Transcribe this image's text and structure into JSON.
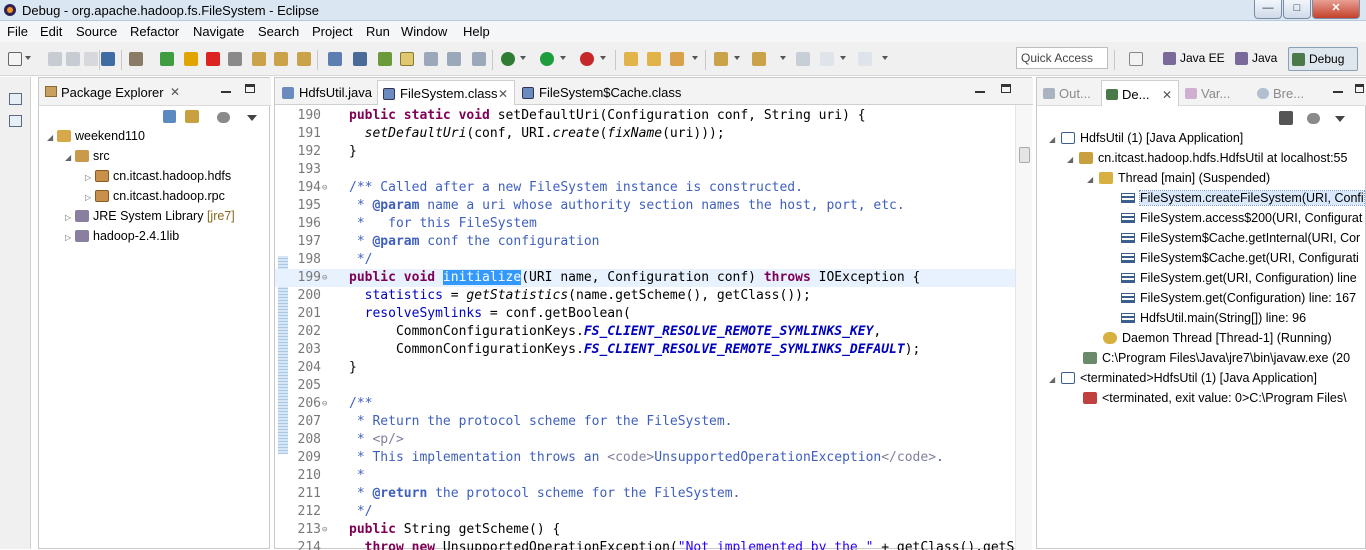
{
  "window": {
    "title": "Debug - org.apache.hadoop.fs.FileSystem - Eclipse"
  },
  "menu": [
    "File",
    "Edit",
    "Source",
    "Refactor",
    "Navigate",
    "Search",
    "Project",
    "Run",
    "Window",
    "Help"
  ],
  "quick_access": {
    "placeholder": "Quick Access"
  },
  "perspectives": [
    "Java EE",
    "Java",
    "Debug"
  ],
  "package_explorer": {
    "title": "Package Explorer",
    "items": [
      {
        "label": "weekend110"
      },
      {
        "label": "src"
      },
      {
        "label": "cn.itcast.hadoop.hdfs"
      },
      {
        "label": "cn.itcast.hadoop.rpc"
      },
      {
        "label": "JRE System Library",
        "decoration": "[jre7]"
      },
      {
        "label": "hadoop-2.4.1lib"
      }
    ]
  },
  "editor": {
    "tabs": [
      "HdfsUtil.java",
      "FileSystem.class",
      "FileSystem$Cache.class"
    ],
    "line_numbers": [
      "190",
      "191",
      "192",
      "193",
      "194",
      "195",
      "196",
      "197",
      "198",
      "199",
      "200",
      "201",
      "202",
      "203",
      "204",
      "205",
      "206",
      "207",
      "208",
      "209",
      "210",
      "211",
      "212",
      "213",
      "214"
    ]
  },
  "debug_view": {
    "tabs": [
      "Out...",
      "De...",
      "Var...",
      "Bre..."
    ],
    "nodes": [
      {
        "label": "HdfsUtil (1) [Java Application]"
      },
      {
        "label": "cn.itcast.hadoop.hdfs.HdfsUtil at localhost:55"
      },
      {
        "label": "Thread [main] (Suspended)"
      },
      {
        "label": "FileSystem.createFileSystem(URI, Confi"
      },
      {
        "label": "FileSystem.access$200(URI, Configurat"
      },
      {
        "label": "FileSystem$Cache.getInternal(URI, Cor"
      },
      {
        "label": "FileSystem$Cache.get(URI, Configurati"
      },
      {
        "label": "FileSystem.get(URI, Configuration) line"
      },
      {
        "label": "FileSystem.get(Configuration) line: 167"
      },
      {
        "label": "HdfsUtil.main(String[]) line: 96"
      },
      {
        "label": "Daemon Thread [Thread-1] (Running)"
      },
      {
        "label": "C:\\Program Files\\Java\\jre7\\bin\\javaw.exe (20"
      },
      {
        "label": "<terminated>HdfsUtil (1) [Java Application]"
      },
      {
        "label": "<terminated, exit value: 0>C:\\Program Files\\"
      }
    ]
  },
  "colors": {
    "keyword": "#7f0055",
    "comment": "#3f5fbf",
    "field": "#0000c0",
    "string": "#2a00ff",
    "selection": "#3399ff"
  }
}
